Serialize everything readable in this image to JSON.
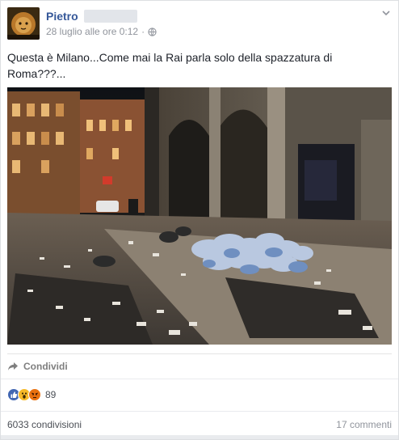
{
  "post": {
    "author": "Pietro",
    "timestamp": "28 luglio alle ore 0:12",
    "separator": "·",
    "privacy_icon": "globe-icon",
    "menu_icon": "chevron-down-icon",
    "message": "Questa è Milano...Come mai la Rai parla solo della spazzatura di Roma???...",
    "photo_icon": "street-photo"
  },
  "actions": {
    "share_label": "Condividi",
    "share_icon": "share-arrow-icon"
  },
  "reactions": {
    "icons": [
      "like-icon",
      "wow-icon",
      "angry-icon"
    ],
    "count": "89"
  },
  "stats": {
    "shares": "6033 condivisioni",
    "comments": "17 commenti"
  },
  "colors": {
    "link": "#365899",
    "like": "#4267b2",
    "wow": "#f7b928",
    "angry": "#e9710f",
    "secondary_text": "#90949c"
  }
}
